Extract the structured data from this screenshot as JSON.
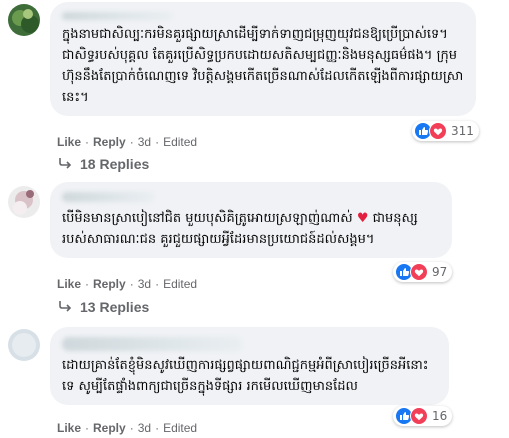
{
  "comments": [
    {
      "text": "ក្នុងនាមជាសិល្បៈករមិនគួរផ្សាយស្រាដើម្បីទាក់ទាញជម្រុញយុវជនឱ្យប្រើប្រាស់ទេ។ ជាសិទ្ធរបស់បុគ្គល តែគួរប្រើសិទ្ធប្រកបដោយសតិសម្បជញ្ញៈនិងមនុស្សធម៌ផង។ ក្រុមហ៊ុននឹងតែប្រាក់ចំណេញទេ វិបត្តិសង្គមកើតច្រើនណាស់ដែលកើតឡើងពីការផ្សាយស្រានេះ។",
      "like_label": "Like",
      "reply_label": "Reply",
      "time": "3d",
      "edited": "Edited",
      "reaction_count": "311",
      "reaction_icons": [
        "like-icon",
        "heart-icon"
      ],
      "replies_label": "18 Replies"
    },
    {
      "text_before_heart": "បើមិនមានស្រាបៀនៅជិត មួយបុសិគិត្រូអោយស្រឡាញ់ណាស់",
      "text_after_heart": " ជាមនុស្សរបស់សាធារណៈជន គួរជួយផ្សាយអ្វីដែរមានប្រយោជន៍ដល់សង្គម។",
      "like_label": "Like",
      "reply_label": "Reply",
      "time": "3d",
      "edited": "Edited",
      "reaction_count": "97",
      "reaction_icons": [
        "like-icon",
        "heart-icon"
      ],
      "replies_label": "13 Replies"
    },
    {
      "text": "ដោយគ្រាន់តែខ្ញុំមិនសូវឃើញការផ្សព្វផ្សាយពាណិជ្ជកម្មអំពីស្រាបៀរច្រើនអីនោះទេ សូម្បីតែផ្ទាំងពាក្យជាច្រើនក្នុងទីផ្សារ រកមើលឃើញមានដែល",
      "like_label": "Like",
      "reply_label": "Reply",
      "time": "3d",
      "edited": "Edited",
      "reaction_count": "16",
      "reaction_icons": [
        "like-icon",
        "heart-icon"
      ]
    }
  ],
  "colors": {
    "bubble": "#f0f2f5",
    "meta_text": "#65676b",
    "like_blue": "#1877f2",
    "heart_red": "#f33e58"
  }
}
